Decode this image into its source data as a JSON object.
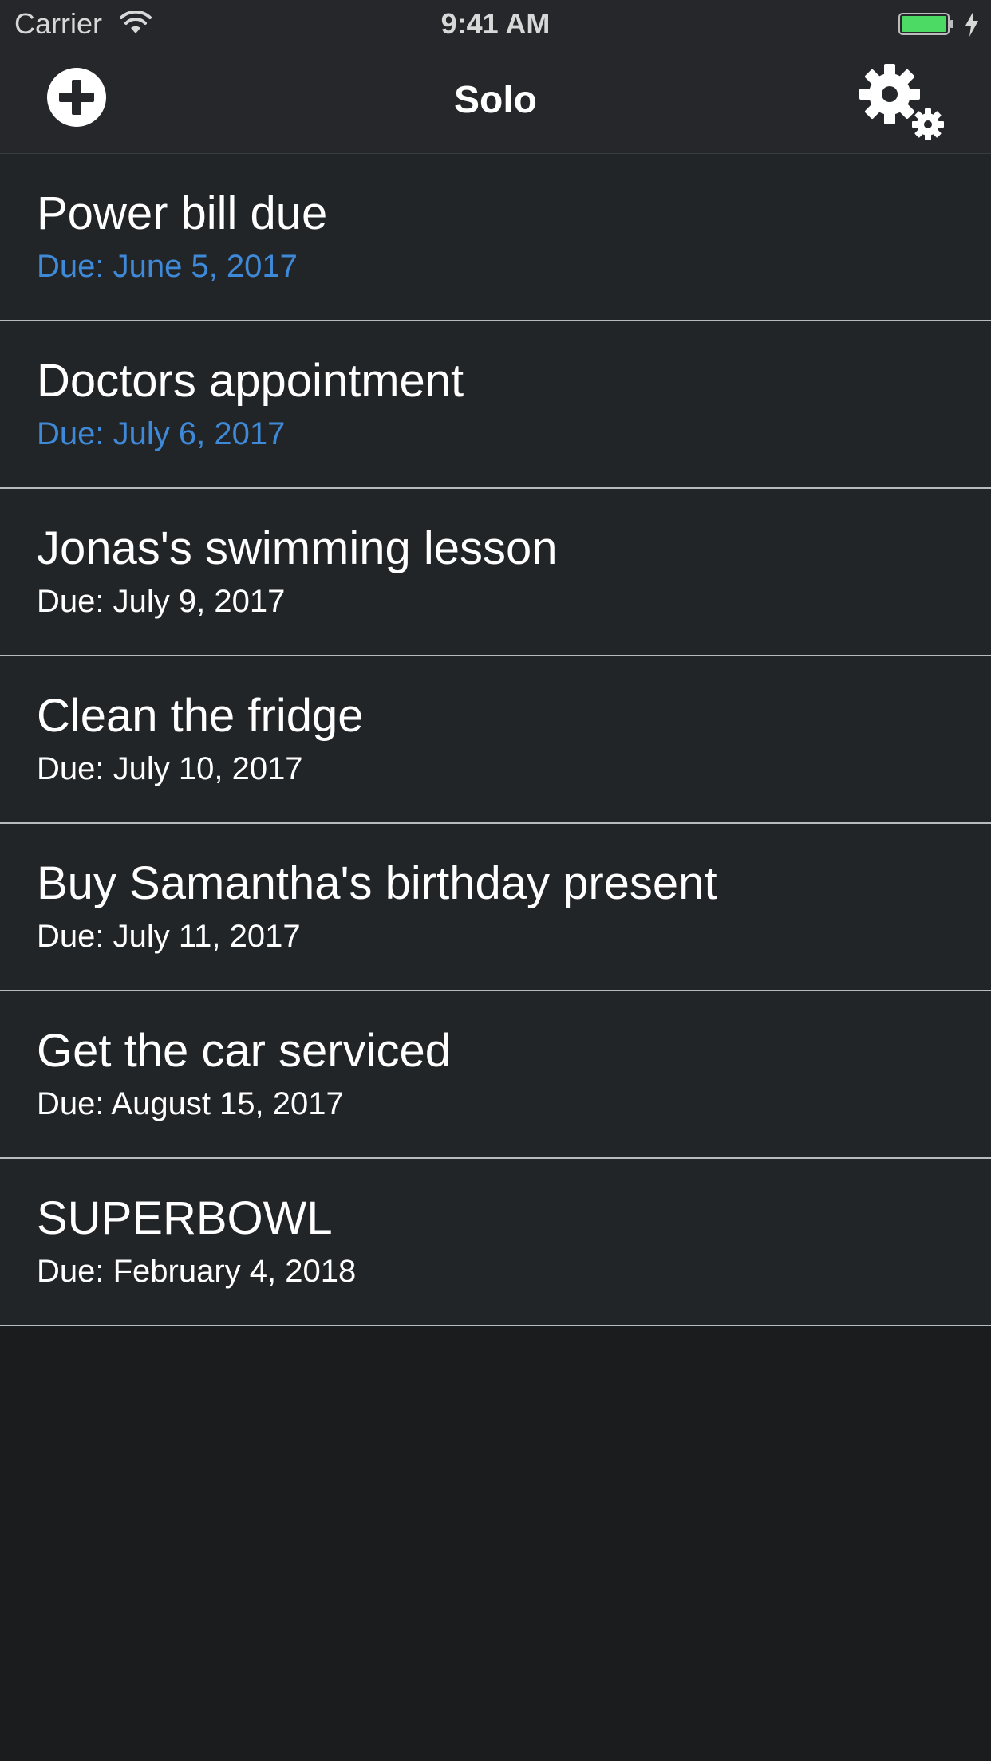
{
  "status_bar": {
    "carrier": "Carrier",
    "time": "9:41 AM"
  },
  "nav": {
    "title": "Solo",
    "add_icon": "plus-circle-icon",
    "settings_icon": "gears-icon"
  },
  "colors": {
    "background": "#1a1c1e",
    "row_background": "#222528",
    "separator": "#b9bcbf",
    "highlight_due": "#3f8ad8",
    "normal_due": "#ffffff",
    "battery": "#4cd964"
  },
  "tasks": [
    {
      "title": "Power bill due",
      "due": "Due: June 5, 2017",
      "highlight": true
    },
    {
      "title": "Doctors appointment",
      "due": "Due: July 6, 2017",
      "highlight": true
    },
    {
      "title": "Jonas's swimming lesson",
      "due": "Due: July 9, 2017",
      "highlight": false
    },
    {
      "title": "Clean the fridge",
      "due": "Due: July 10, 2017",
      "highlight": false
    },
    {
      "title": "Buy Samantha's birthday present",
      "due": "Due: July 11, 2017",
      "highlight": false
    },
    {
      "title": "Get the car serviced",
      "due": "Due: August 15, 2017",
      "highlight": false
    },
    {
      "title": "SUPERBOWL",
      "due": "Due: February 4, 2018",
      "highlight": false
    }
  ]
}
